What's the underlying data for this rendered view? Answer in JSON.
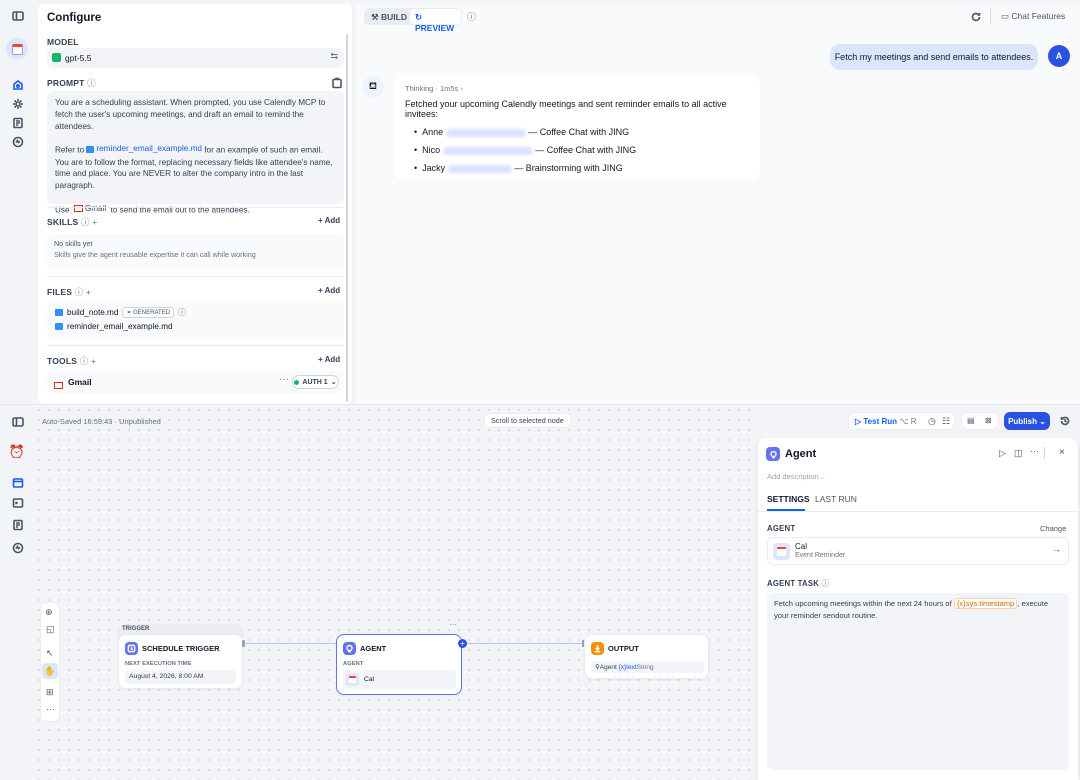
{
  "configure": {
    "title": "Configure",
    "model_label": "MODEL",
    "model_value": "gpt-5.5",
    "prompt_label": "PROMPT",
    "prompt": {
      "p1": "You are a scheduling assistant. When prompted, you use Calendly MCP to fetch the user's upcoming meetings, and draft an email to remind the attendees.",
      "p2_a": "Refer to",
      "p2_chip": "reminder_email_example.md",
      "p2_b": "for an example of such an email. You are to follow the format, replacing necessary fields like attendee's name, time and place. You are NEVER to alter the company intro in the last paragraph.",
      "p3_a": "Use",
      "p3_chip": "Gmail",
      "p3_b": "to send the email out to the attendees."
    },
    "skills_label": "SKILLS",
    "add_label": "+ Add",
    "skills_empty_title": "No skills yet",
    "skills_empty_desc": "Skills give the agent reusable expertise it can call while working",
    "files_label": "FILES",
    "files": [
      {
        "name": "build_note.md",
        "badge": "GENERATED"
      },
      {
        "name": "reminder_email_example.md"
      }
    ],
    "tools_label": "TOOLS",
    "tool_name": "Gmail",
    "tool_auth": "AUTH 1"
  },
  "preview": {
    "tab_build": "BUILD",
    "tab_preview": "PREVIEW",
    "chat_features": "Chat Features",
    "user_message": "Fetch my meetings and send emails to attendees.",
    "avatar": "A",
    "thinking": "Thinking · 1m5s",
    "reply_intro": "Fetched your upcoming Calendly meetings and sent reminder emails to all active invitees:",
    "items": [
      {
        "name": "Anne",
        "desc": "— Coffee Chat with JING"
      },
      {
        "name": "Nico",
        "desc": "— Coffee Chat with JING"
      },
      {
        "name": "Jacky",
        "desc": "— Brainstorming with JING"
      }
    ]
  },
  "workflow": {
    "autosave": "Auto-Saved 16:59:43 · Unpublished",
    "scroll_hint": "Scroll to selected node",
    "test_run": "Test Run",
    "test_run_keys": "⌥ R",
    "publish": "Publish",
    "trigger": {
      "tag": "TRIGGER",
      "title": "SCHEDULE TRIGGER",
      "sub_label": "NEXT EXECUTION TIME",
      "value": "August 4, 2026, 8:00 AM"
    },
    "agent": {
      "title": "AGENT",
      "sub_label": "AGENT",
      "value": "Cal"
    },
    "output": {
      "title": "OUTPUT",
      "var_agent": "Agent",
      "var_name": "text",
      "var_type": "String"
    }
  },
  "inspector": {
    "title": "Agent",
    "description_placeholder": "Add description...",
    "tab_settings": "SETTINGS",
    "tab_last_run": "LAST RUN",
    "agent_label": "AGENT",
    "change": "Change",
    "agent_name": "Cal",
    "agent_sub": "Event Reminder",
    "task_label": "AGENT TASK",
    "task_a": "Fetch upcoming meetings within the next 24 hours of",
    "task_var": "sys.timestamp",
    "task_b": ", execute your reminder sendout routine."
  },
  "colors": {
    "accent": "#155eef",
    "publish": "#2952e3",
    "purple": "#6172f3",
    "orange": "#f79009"
  }
}
